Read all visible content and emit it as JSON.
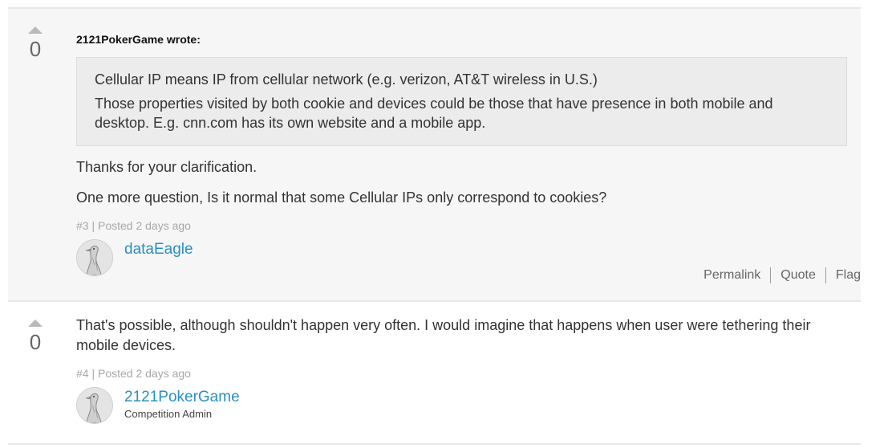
{
  "posts": [
    {
      "vote_count": "0",
      "quote": {
        "author_line": "2121PokerGame wrote:",
        "paragraphs": [
          "Cellular IP means IP from cellular network (e.g. verizon, AT&T wireless in U.S.)",
          "Those properties visited by both cookie and devices could be those that have presence in both mobile and desktop. E.g. cnn.com has its own website and a mobile app."
        ]
      },
      "paragraphs": [
        "Thanks for your clarification.",
        "One more question, Is it normal that some Cellular IPs only correspond to cookies?"
      ],
      "meta": "#3 | Posted 2 days ago",
      "author": "dataEagle",
      "actions": [
        "Permalink",
        "Quote",
        "Flag"
      ]
    },
    {
      "vote_count": "0",
      "paragraphs": [
        "That's possible, although shouldn't happen very often. I would imagine that happens when user were tethering their mobile devices."
      ],
      "meta": "#4 | Posted 2 days ago",
      "author": "2121PokerGame",
      "author_role": "Competition Admin"
    }
  ]
}
